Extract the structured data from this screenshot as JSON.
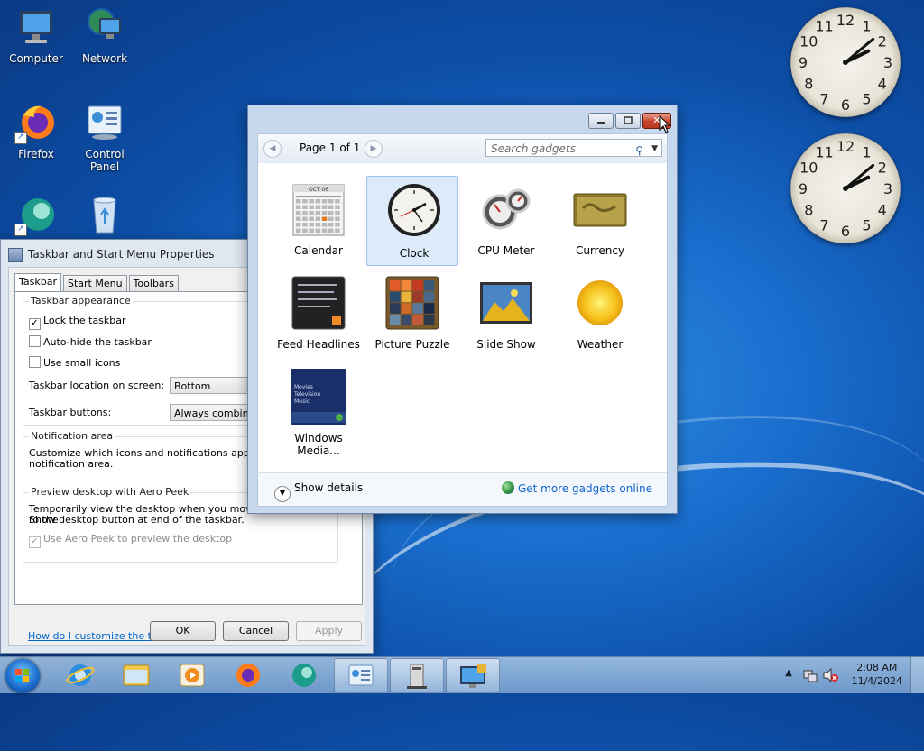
{
  "desktop": {
    "icons": [
      {
        "label": "Computer"
      },
      {
        "label": "Network"
      },
      {
        "label": "Firefox"
      },
      {
        "label": "Control Panel"
      }
    ]
  },
  "taskbar_props": {
    "title": "Taskbar and Start Menu Properties",
    "tabs": [
      "Taskbar",
      "Start Menu",
      "Toolbars"
    ],
    "appearance_title": "Taskbar appearance",
    "lock_label": "Lock the taskbar",
    "lock_checked": true,
    "autohide_label": "Auto-hide the taskbar",
    "smallicons_label": "Use small icons",
    "location_label": "Taskbar location on screen:",
    "location_value": "Bottom",
    "buttons_label": "Taskbar buttons:",
    "buttons_value": "Always combine",
    "notif_title": "Notification area",
    "notif_text_1": "Customize which icons and notifications appear in",
    "notif_text_2": "notification area.",
    "peek_title": "Preview desktop with Aero Peek",
    "peek_text_1": "Temporarily view the desktop when you move your mouse to the",
    "peek_text_2": "Show desktop button at end of the taskbar.",
    "peek_check_label": "Use Aero Peek to preview the desktop",
    "help_link": "How do I customize the taskbar?",
    "ok_label": "OK",
    "cancel_label": "Cancel",
    "apply_label": "Apply"
  },
  "gadgets": {
    "page_label": "Page 1 of 1",
    "search_placeholder": "Search gadgets",
    "items": [
      {
        "label": "Calendar"
      },
      {
        "label": "Clock",
        "selected": true
      },
      {
        "label": "CPU Meter"
      },
      {
        "label": "Currency"
      },
      {
        "label": "Feed Headlines"
      },
      {
        "label": "Picture Puzzle"
      },
      {
        "label": "Slide Show"
      },
      {
        "label": "Weather"
      },
      {
        "label": "Windows Media..."
      }
    ],
    "calendar_month": "OCT 06",
    "wmc_lines": [
      "Movies",
      "Television",
      "Music"
    ],
    "show_details": "Show details",
    "get_more": "Get more gadgets online"
  },
  "clock_faces": {
    "numbers": [
      "12",
      "1",
      "2",
      "3",
      "4",
      "5",
      "6",
      "7",
      "8",
      "9",
      "10",
      "11"
    ]
  },
  "tray": {
    "time": "2:08 AM",
    "date": "11/4/2024"
  }
}
